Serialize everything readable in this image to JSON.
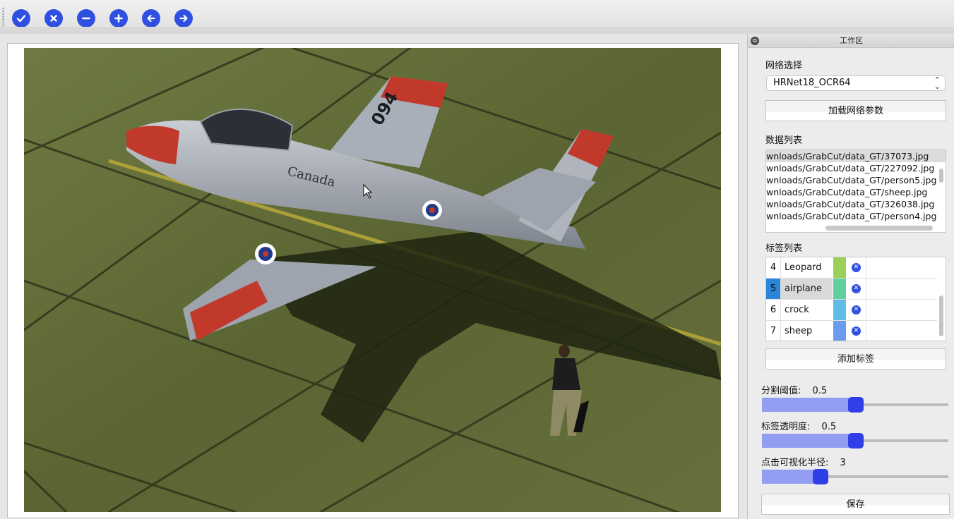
{
  "toolbar": {
    "buttons": [
      {
        "name": "confirm-icon"
      },
      {
        "name": "clear-icon"
      },
      {
        "name": "remove-icon"
      },
      {
        "name": "add-icon"
      },
      {
        "name": "previous-icon"
      },
      {
        "name": "next-icon"
      }
    ],
    "accent": "#2f4fe0"
  },
  "image": {
    "aircraft_number": "094",
    "aircraft_text": "Canada"
  },
  "dock": {
    "title": "工作区",
    "network_label": "网络选择",
    "network_value": "HRNet18_OCR64",
    "load_params_button": "加载网络参数",
    "data_list_label": "数据列表",
    "data_list": [
      "wnloads/GrabCut/data_GT/37073.jpg",
      "wnloads/GrabCut/data_GT/227092.jpg",
      "wnloads/GrabCut/data_GT/person5.jpg",
      "wnloads/GrabCut/data_GT/sheep.jpg",
      "wnloads/GrabCut/data_GT/326038.jpg",
      "wnloads/GrabCut/data_GT/person4.jpg"
    ],
    "label_list_label": "标签列表",
    "labels": [
      {
        "index": "4",
        "name": "Leopard",
        "color": "#9ccf5a"
      },
      {
        "index": "5",
        "name": "airplane",
        "color": "#5fcf9c"
      },
      {
        "index": "6",
        "name": "crock",
        "color": "#5fbde8"
      },
      {
        "index": "7",
        "name": "sheep",
        "color": "#6a9bef"
      }
    ],
    "add_label_button": "添加标签",
    "threshold_label": "分割阈值:",
    "threshold_value": "0.5",
    "opacity_label": "标签透明度:",
    "opacity_value": "0.5",
    "radius_label": "点击可视化半径:",
    "radius_value": "3",
    "save_button": "保存"
  }
}
